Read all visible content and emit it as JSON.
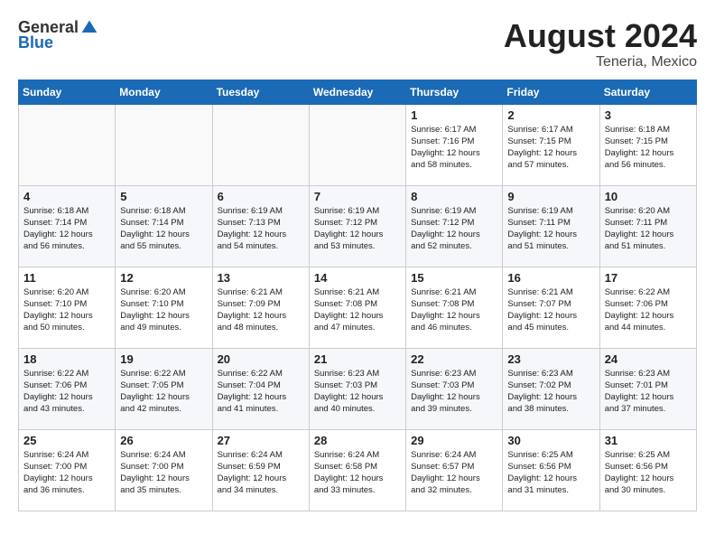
{
  "header": {
    "logo": {
      "general": "General",
      "blue": "Blue"
    },
    "title": "August 2024",
    "location": "Teneria, Mexico"
  },
  "days_of_week": [
    "Sunday",
    "Monday",
    "Tuesday",
    "Wednesday",
    "Thursday",
    "Friday",
    "Saturday"
  ],
  "weeks": [
    [
      {
        "day": "",
        "info": ""
      },
      {
        "day": "",
        "info": ""
      },
      {
        "day": "",
        "info": ""
      },
      {
        "day": "",
        "info": ""
      },
      {
        "day": "1",
        "info": "Sunrise: 6:17 AM\nSunset: 7:16 PM\nDaylight: 12 hours\nand 58 minutes."
      },
      {
        "day": "2",
        "info": "Sunrise: 6:17 AM\nSunset: 7:15 PM\nDaylight: 12 hours\nand 57 minutes."
      },
      {
        "day": "3",
        "info": "Sunrise: 6:18 AM\nSunset: 7:15 PM\nDaylight: 12 hours\nand 56 minutes."
      }
    ],
    [
      {
        "day": "4",
        "info": "Sunrise: 6:18 AM\nSunset: 7:14 PM\nDaylight: 12 hours\nand 56 minutes."
      },
      {
        "day": "5",
        "info": "Sunrise: 6:18 AM\nSunset: 7:14 PM\nDaylight: 12 hours\nand 55 minutes."
      },
      {
        "day": "6",
        "info": "Sunrise: 6:19 AM\nSunset: 7:13 PM\nDaylight: 12 hours\nand 54 minutes."
      },
      {
        "day": "7",
        "info": "Sunrise: 6:19 AM\nSunset: 7:12 PM\nDaylight: 12 hours\nand 53 minutes."
      },
      {
        "day": "8",
        "info": "Sunrise: 6:19 AM\nSunset: 7:12 PM\nDaylight: 12 hours\nand 52 minutes."
      },
      {
        "day": "9",
        "info": "Sunrise: 6:19 AM\nSunset: 7:11 PM\nDaylight: 12 hours\nand 51 minutes."
      },
      {
        "day": "10",
        "info": "Sunrise: 6:20 AM\nSunset: 7:11 PM\nDaylight: 12 hours\nand 51 minutes."
      }
    ],
    [
      {
        "day": "11",
        "info": "Sunrise: 6:20 AM\nSunset: 7:10 PM\nDaylight: 12 hours\nand 50 minutes."
      },
      {
        "day": "12",
        "info": "Sunrise: 6:20 AM\nSunset: 7:10 PM\nDaylight: 12 hours\nand 49 minutes."
      },
      {
        "day": "13",
        "info": "Sunrise: 6:21 AM\nSunset: 7:09 PM\nDaylight: 12 hours\nand 48 minutes."
      },
      {
        "day": "14",
        "info": "Sunrise: 6:21 AM\nSunset: 7:08 PM\nDaylight: 12 hours\nand 47 minutes."
      },
      {
        "day": "15",
        "info": "Sunrise: 6:21 AM\nSunset: 7:08 PM\nDaylight: 12 hours\nand 46 minutes."
      },
      {
        "day": "16",
        "info": "Sunrise: 6:21 AM\nSunset: 7:07 PM\nDaylight: 12 hours\nand 45 minutes."
      },
      {
        "day": "17",
        "info": "Sunrise: 6:22 AM\nSunset: 7:06 PM\nDaylight: 12 hours\nand 44 minutes."
      }
    ],
    [
      {
        "day": "18",
        "info": "Sunrise: 6:22 AM\nSunset: 7:06 PM\nDaylight: 12 hours\nand 43 minutes."
      },
      {
        "day": "19",
        "info": "Sunrise: 6:22 AM\nSunset: 7:05 PM\nDaylight: 12 hours\nand 42 minutes."
      },
      {
        "day": "20",
        "info": "Sunrise: 6:22 AM\nSunset: 7:04 PM\nDaylight: 12 hours\nand 41 minutes."
      },
      {
        "day": "21",
        "info": "Sunrise: 6:23 AM\nSunset: 7:03 PM\nDaylight: 12 hours\nand 40 minutes."
      },
      {
        "day": "22",
        "info": "Sunrise: 6:23 AM\nSunset: 7:03 PM\nDaylight: 12 hours\nand 39 minutes."
      },
      {
        "day": "23",
        "info": "Sunrise: 6:23 AM\nSunset: 7:02 PM\nDaylight: 12 hours\nand 38 minutes."
      },
      {
        "day": "24",
        "info": "Sunrise: 6:23 AM\nSunset: 7:01 PM\nDaylight: 12 hours\nand 37 minutes."
      }
    ],
    [
      {
        "day": "25",
        "info": "Sunrise: 6:24 AM\nSunset: 7:00 PM\nDaylight: 12 hours\nand 36 minutes."
      },
      {
        "day": "26",
        "info": "Sunrise: 6:24 AM\nSunset: 7:00 PM\nDaylight: 12 hours\nand 35 minutes."
      },
      {
        "day": "27",
        "info": "Sunrise: 6:24 AM\nSunset: 6:59 PM\nDaylight: 12 hours\nand 34 minutes."
      },
      {
        "day": "28",
        "info": "Sunrise: 6:24 AM\nSunset: 6:58 PM\nDaylight: 12 hours\nand 33 minutes."
      },
      {
        "day": "29",
        "info": "Sunrise: 6:24 AM\nSunset: 6:57 PM\nDaylight: 12 hours\nand 32 minutes."
      },
      {
        "day": "30",
        "info": "Sunrise: 6:25 AM\nSunset: 6:56 PM\nDaylight: 12 hours\nand 31 minutes."
      },
      {
        "day": "31",
        "info": "Sunrise: 6:25 AM\nSunset: 6:56 PM\nDaylight: 12 hours\nand 30 minutes."
      }
    ]
  ]
}
